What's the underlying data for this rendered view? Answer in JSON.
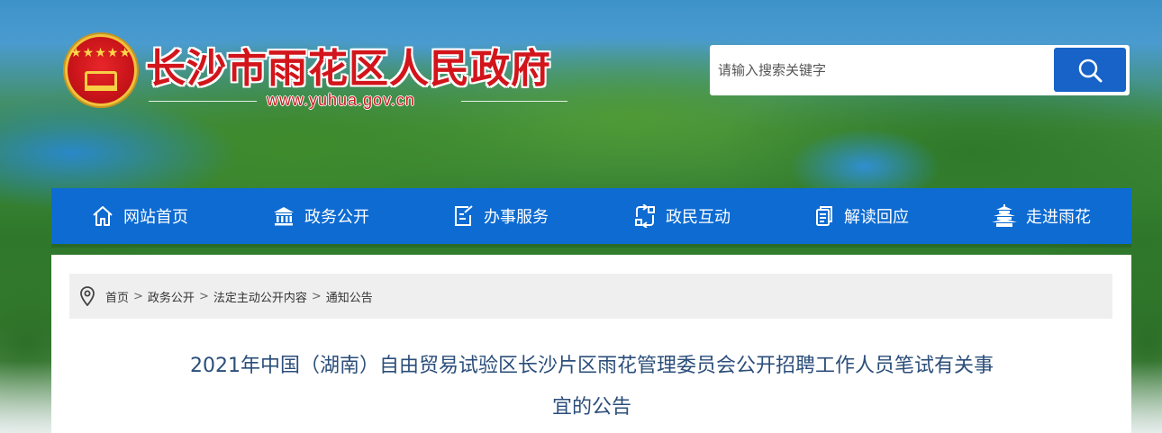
{
  "header": {
    "site_title": "长沙市雨花区人民政府",
    "site_url": "www.yuhua.gov.cn",
    "emblem_stars": "★★★★★"
  },
  "search": {
    "placeholder": "请输入搜索关键字",
    "button_icon": "search-icon"
  },
  "nav": {
    "items": [
      {
        "label": "网站首页",
        "icon": "home-icon"
      },
      {
        "label": "政务公开",
        "icon": "government-building-icon"
      },
      {
        "label": "办事服务",
        "icon": "edit-document-icon"
      },
      {
        "label": "政民互动",
        "icon": "interaction-icon"
      },
      {
        "label": "解读回应",
        "icon": "document-copy-icon"
      },
      {
        "label": "走进雨花",
        "icon": "pagoda-icon"
      }
    ]
  },
  "breadcrumb": {
    "icon": "location-pin-icon",
    "items": [
      "首页",
      "政务公开",
      "法定主动公开内容",
      "通知公告"
    ],
    "separator": ">"
  },
  "article": {
    "title_line1": "2021年中国（湖南）自由贸易试验区长沙片区雨花管理委员会公开招聘工作人员笔试有关事",
    "title_line2": "宜的公告"
  },
  "colors": {
    "nav_bg": "#0d6bd2",
    "search_button": "#1763c7",
    "title_red": "#d2151b",
    "article_title": "#2b4e7a"
  }
}
